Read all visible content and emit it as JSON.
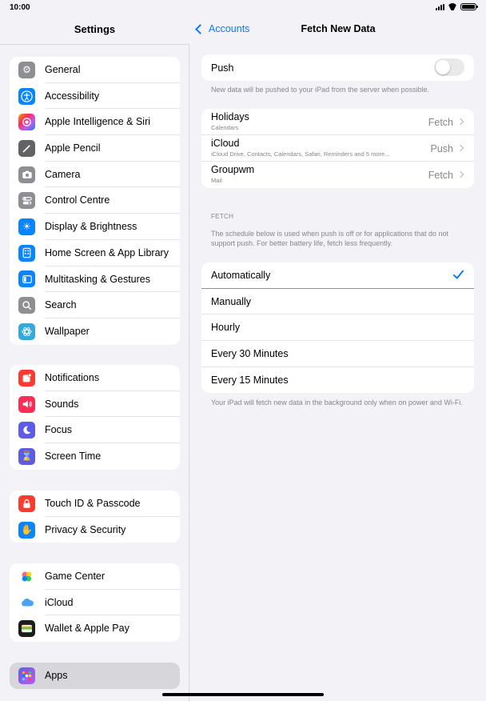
{
  "status": {
    "time": "10:00"
  },
  "sidebar": {
    "title": "Settings",
    "groups": [
      {
        "items": [
          {
            "label": "General",
            "icon": "gear-icon",
            "color": "#8e8e93"
          },
          {
            "label": "Accessibility",
            "icon": "accessibility-icon",
            "color": "#0a84ff"
          },
          {
            "label": "Apple Intelligence & Siri",
            "icon": "siri-icon",
            "color": "#c65bd8"
          },
          {
            "label": "Apple Pencil",
            "icon": "pencil-icon",
            "color": "#636366"
          },
          {
            "label": "Camera",
            "icon": "camera-icon",
            "color": "#8e8e93"
          },
          {
            "label": "Control Centre",
            "icon": "control-centre-icon",
            "color": "#8e8e93"
          },
          {
            "label": "Display & Brightness",
            "icon": "brightness-icon",
            "color": "#0a84ff"
          },
          {
            "label": "Home Screen & App Library",
            "icon": "home-screen-icon",
            "color": "#0a84ff"
          },
          {
            "label": "Multitasking & Gestures",
            "icon": "multitasking-icon",
            "color": "#0a84ff"
          },
          {
            "label": "Search",
            "icon": "search-icon",
            "color": "#8e8e93"
          },
          {
            "label": "Wallpaper",
            "icon": "wallpaper-icon",
            "color": "#34aadc"
          }
        ]
      },
      {
        "items": [
          {
            "label": "Notifications",
            "icon": "notifications-icon",
            "color": "#ff3b30"
          },
          {
            "label": "Sounds",
            "icon": "sounds-icon",
            "color": "#ff2d55"
          },
          {
            "label": "Focus",
            "icon": "moon-icon",
            "color": "#5e5ce6"
          },
          {
            "label": "Screen Time",
            "icon": "hourglass-icon",
            "color": "#5e5ce6"
          }
        ]
      },
      {
        "items": [
          {
            "label": "Touch ID & Passcode",
            "icon": "lock-icon",
            "color": "#ff3b30"
          },
          {
            "label": "Privacy & Security",
            "icon": "hand-icon",
            "color": "#0a84ff"
          }
        ]
      },
      {
        "items": [
          {
            "label": "Game Center",
            "icon": "game-center-icon",
            "color": "#ffffff"
          },
          {
            "label": "iCloud",
            "icon": "cloud-icon",
            "color": "#ffffff"
          },
          {
            "label": "Wallet & Apple Pay",
            "icon": "wallet-icon",
            "color": "#1c1c1e"
          }
        ]
      },
      {
        "items": [
          {
            "label": "Apps",
            "icon": "apps-icon",
            "color": "#5e5ce6"
          }
        ]
      }
    ]
  },
  "detail": {
    "back_label": "Accounts",
    "title": "Fetch New Data",
    "push": {
      "label": "Push",
      "on": false,
      "footnote": "New data will be pushed to your iPad from the server when possible."
    },
    "accounts": [
      {
        "name": "Holidays",
        "sub": "Calendars",
        "value": "Fetch"
      },
      {
        "name": "iCloud",
        "sub": "iCloud Drive, Contacts, Calendars, Safari, Reminders and 5 more...",
        "value": "Push"
      },
      {
        "name": "Groupwm",
        "sub": "Mail",
        "value": "Fetch"
      }
    ],
    "fetch_header": "FETCH",
    "fetch_footnote": "The schedule below is used when push is off or for applications that do not support push. For better battery life, fetch less frequently.",
    "options": [
      {
        "label": "Automatically",
        "selected": true
      },
      {
        "label": "Manually",
        "selected": false
      },
      {
        "label": "Hourly",
        "selected": false
      },
      {
        "label": "Every 30 Minutes",
        "selected": false
      },
      {
        "label": "Every 15 Minutes",
        "selected": false
      }
    ],
    "bottom_footnote": "Your iPad will fetch new data in the background only when on power and Wi-Fi."
  },
  "colors": {
    "accent": "#0a7aff",
    "secondary_text": "#86868b"
  }
}
